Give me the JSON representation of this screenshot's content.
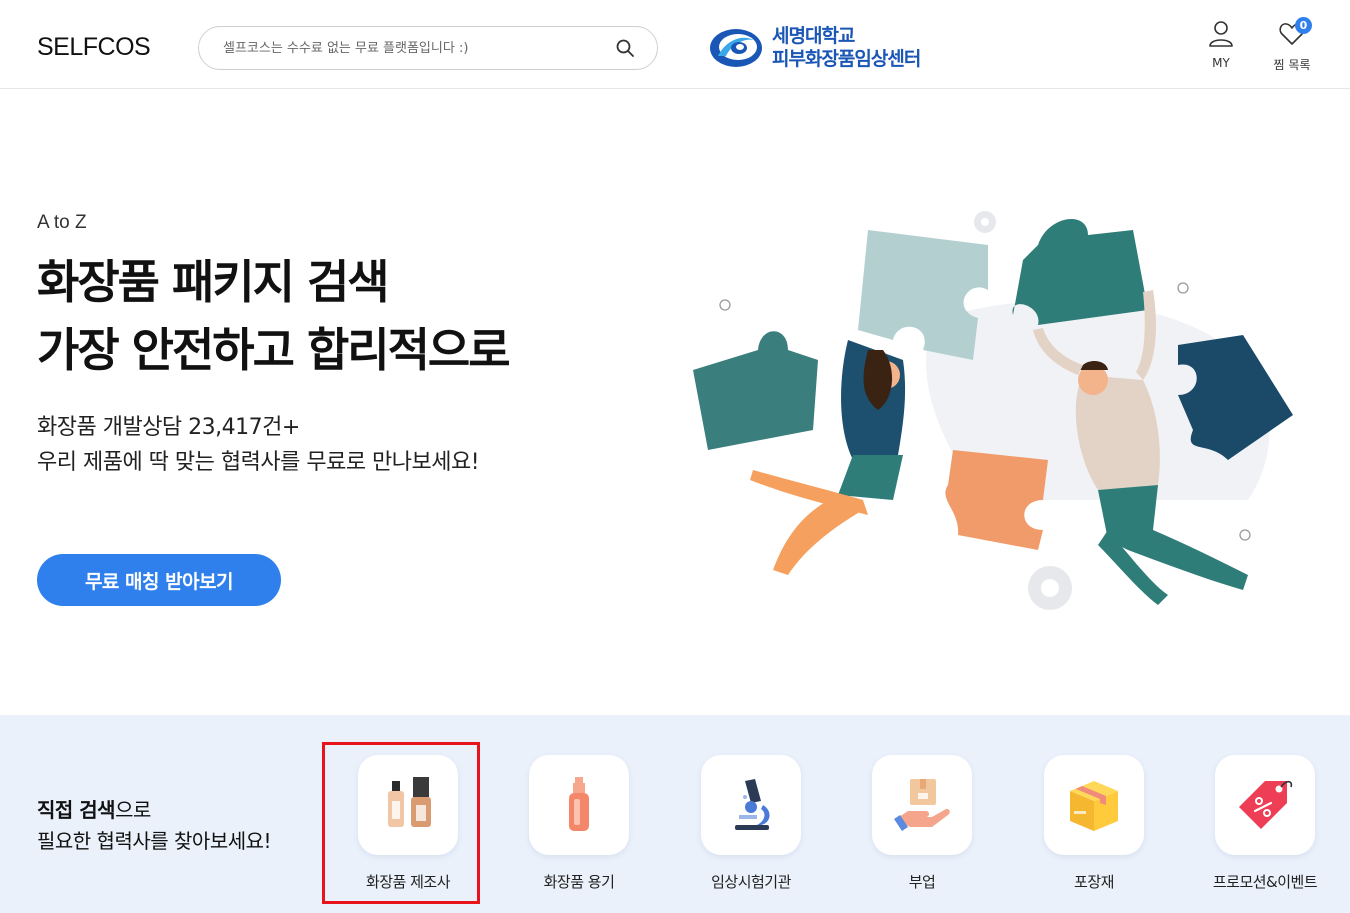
{
  "header": {
    "logo": "SELFCOS",
    "search_placeholder": "셀프코스는 수수료 없는 무료 플랫폼입니다 :)",
    "partner_line1": "세명대학교",
    "partner_line2": "피부화장품임상센터",
    "my_label": "MY",
    "wishlist_label": "찜 목록",
    "wishlist_count": "0"
  },
  "hero": {
    "eyebrow": "A to Z",
    "title_line1": "화장품 패키지 검색",
    "title_line2": "가장 안전하고 합리적으로",
    "desc_line1": "화장품 개발상담 23,417건+",
    "desc_line2": "우리 제품에 딱 맞는 협력사를 무료로 만나보세요!",
    "cta_label": "무료 매칭 받아보기"
  },
  "categories": {
    "intro_bold": "직접 검색",
    "intro_rest": "으로",
    "intro_line2": "필요한 협력사를 찾아보세요!",
    "items": [
      {
        "label": "화장품 제조사",
        "icon": "foundation-bottles-icon"
      },
      {
        "label": "화장품 용기",
        "icon": "pump-bottle-icon"
      },
      {
        "label": "임상시험기관",
        "icon": "microscope-icon"
      },
      {
        "label": "부업",
        "icon": "hand-box-icon"
      },
      {
        "label": "포장재",
        "icon": "package-box-icon"
      },
      {
        "label": "프로모션&이벤트",
        "icon": "discount-tag-icon"
      }
    ]
  },
  "colors": {
    "accent": "#2f80ed",
    "section_bg": "#eaf1fb",
    "highlight": "#e8141b"
  }
}
